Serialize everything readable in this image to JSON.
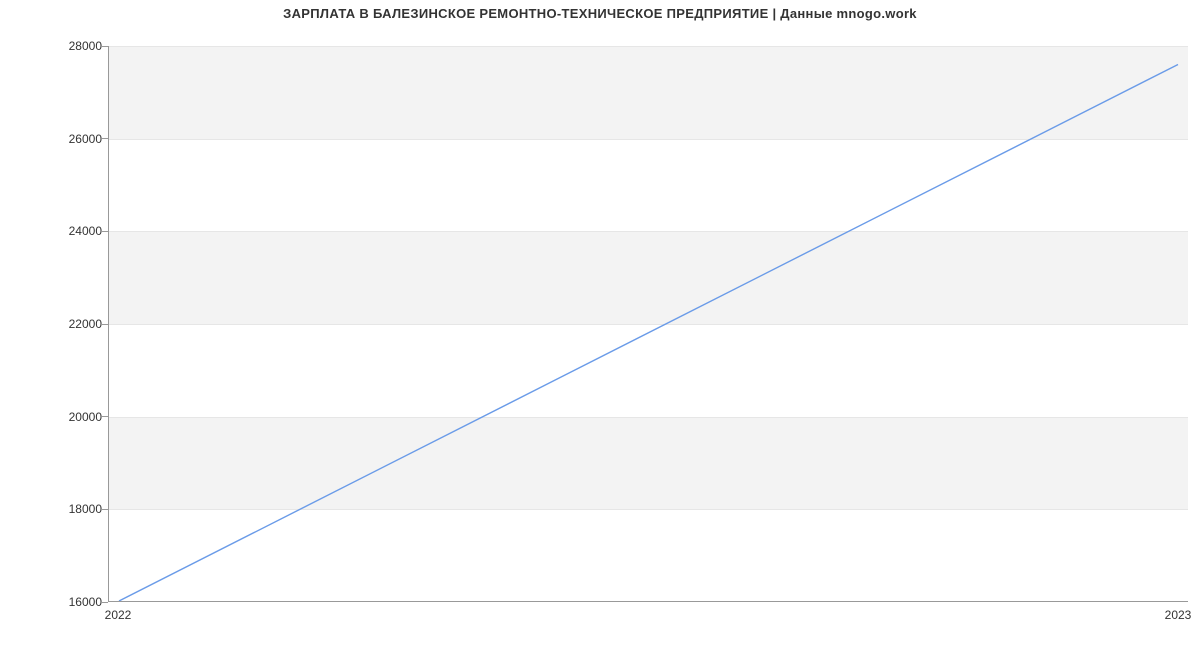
{
  "chart_data": {
    "type": "line",
    "title": "ЗАРПЛАТА В  БАЛЕЗИНСКОЕ РЕМОНТНО-ТЕХНИЧЕСКОЕ ПРЕДПРИЯТИЕ | Данные mnogo.work",
    "x": [
      "2022",
      "2023"
    ],
    "values": [
      16000,
      27600
    ],
    "xlabel": "",
    "ylabel": "",
    "ylim": [
      16000,
      28000
    ],
    "y_ticks": [
      16000,
      18000,
      20000,
      22000,
      24000,
      26000,
      28000
    ],
    "x_ticks": [
      "2022",
      "2023"
    ],
    "line_color": "#6a9be8",
    "band_color": "#f3f3f3"
  }
}
